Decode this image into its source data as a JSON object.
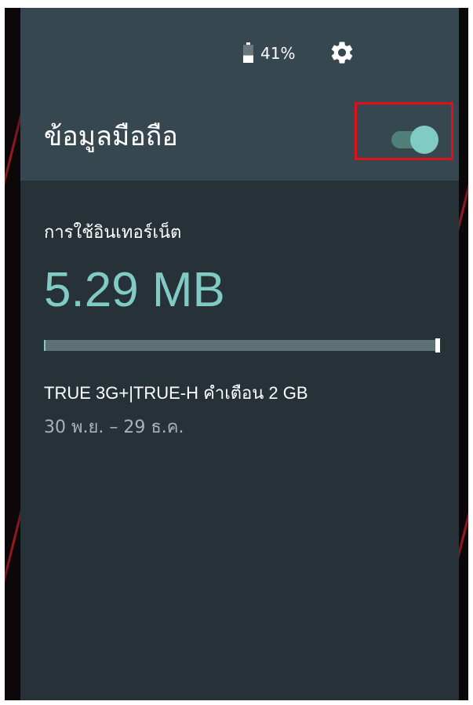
{
  "status": {
    "battery_percent": "41%",
    "battery_level": 0.41
  },
  "header": {
    "title": "ข้อมูลมือถือ",
    "toggle_on": true
  },
  "usage": {
    "label": "การใช้อินเทอร์เน็ต",
    "amount": "5.29 MB",
    "progress_fraction": 0.003
  },
  "plan": {
    "carrier_warning": "TRUE 3G+|TRUE-H คำเตือน 2 GB",
    "period": "30 พ.ย. – 29 ธ.ค."
  },
  "colors": {
    "accent": "#80cbc4",
    "header_bg": "#37474f",
    "body_bg": "#263238",
    "highlight": "#e0101a"
  }
}
